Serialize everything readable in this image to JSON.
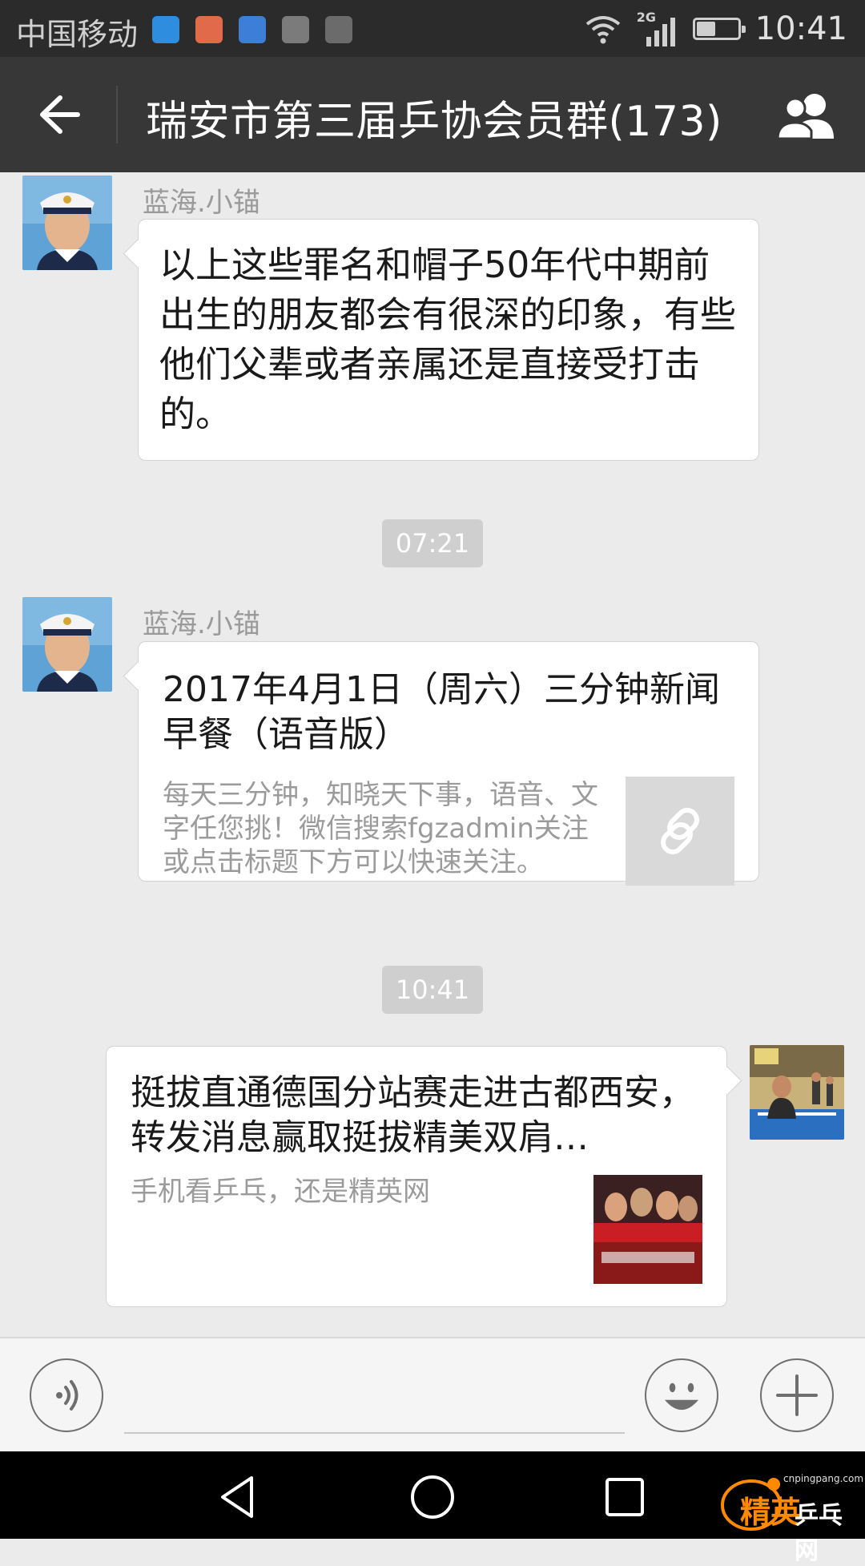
{
  "status_bar": {
    "carrier": "中国移动",
    "network": "2G",
    "time": "10:41",
    "battery_level": 0.45,
    "app_icons": [
      "baidu-icon",
      "mail-icon",
      "health-icon",
      "gallery-icon",
      "photo-icon"
    ]
  },
  "header": {
    "title": "瑞安市第三届乒协会员群(173)"
  },
  "messages": [
    {
      "sender": "蓝海.小锚",
      "text": "以上这些罪名和帽子50年代中期前出生的朋友都会有很深的印象，有些他们父辈或者亲属还是直接受打击的。"
    },
    {
      "time": "07:21"
    },
    {
      "sender": "蓝海.小锚",
      "card_title": "2017年4月1日（周六）三分钟新闻早餐（语音版）",
      "card_desc": "每天三分钟，知晓天下事，语音、文字任您挑！微信搜索fgzadmin关注或点击标题下方可以快速关注。"
    },
    {
      "time": "10:41"
    },
    {
      "outgoing": true,
      "card_title": "挺拔直通德国分站赛走进古都西安，转发消息赢取挺拔精美双肩…",
      "card_desc": "手机看乒乓，还是精英网"
    }
  ],
  "watermark": {
    "text_a": "精英",
    "text_b": "乒乓网",
    "url": "cnpingpang.com"
  },
  "colors": {
    "titlebar_bg": "#373737",
    "statusbar_bg": "#2b2b2b",
    "chat_bg": "#ebebeb",
    "bubble_bg": "#ffffff",
    "timestamp_bg": "#cfcfcf"
  }
}
